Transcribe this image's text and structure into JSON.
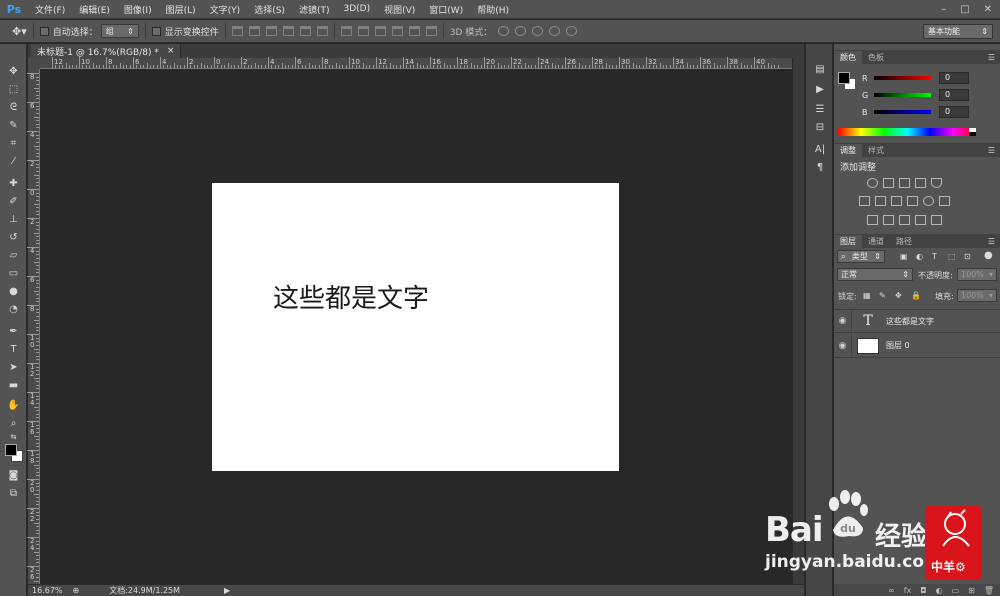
{
  "app": {
    "logo": "Ps"
  },
  "menu": [
    "文件(F)",
    "编辑(E)",
    "图像(I)",
    "图层(L)",
    "文字(Y)",
    "选择(S)",
    "滤镜(T)",
    "3D(D)",
    "视图(V)",
    "窗口(W)",
    "帮助(H)"
  ],
  "window_controls": {
    "minimize": "–",
    "maximize": "□",
    "close": "✕"
  },
  "options": {
    "auto_select_label": "自动选择：",
    "auto_select_value": "组",
    "show_transform_label": "显示变换控件",
    "mode_3d_label": "3D 模式：",
    "workspace": "基本功能"
  },
  "document": {
    "tab_title": "未标题-1 @ 16.7%(RGB/8) *",
    "tab_close": "×",
    "canvas_text": "这些都是文字"
  },
  "ruler": {
    "h_labels": [
      "12",
      "10",
      "8",
      "6",
      "4",
      "2",
      "0",
      "2",
      "4",
      "6",
      "8",
      "10",
      "12",
      "14",
      "16",
      "18",
      "20",
      "22",
      "24",
      "26",
      "28",
      "30",
      "32",
      "34",
      "36",
      "38",
      "40"
    ],
    "v_labels": [
      "8",
      "6",
      "4",
      "2",
      "0",
      "2",
      "4",
      "6",
      "8",
      "1 0",
      "1 2",
      "1 4",
      "1 6",
      "1 8",
      "2 0",
      "2 2",
      "2 4",
      "2 6"
    ]
  },
  "status": {
    "zoom": "16.67%",
    "doc_info": "文档:24.9M/1.25M",
    "arrow": "▶"
  },
  "color_panel": {
    "tabs": [
      "颜色",
      "色板"
    ],
    "sliders": [
      {
        "label": "R",
        "value": "0",
        "gradient": "linear-gradient(to right,#000,#ff0000)"
      },
      {
        "label": "G",
        "value": "0",
        "gradient": "linear-gradient(to right,#000,#00ff00)"
      },
      {
        "label": "B",
        "value": "0",
        "gradient": "linear-gradient(to right,#000,#0000ff)"
      }
    ],
    "foreground": "#000000",
    "background": "#ffffff"
  },
  "adjust_panel": {
    "tabs": [
      "调整",
      "样式"
    ],
    "title": "添加调整"
  },
  "layers_panel": {
    "tabs": [
      "图层",
      "通道",
      "路径"
    ],
    "filter_value": "类型",
    "blend_mode": "正常",
    "opacity_label": "不透明度:",
    "opacity_value": "100%",
    "lock_label": "锁定:",
    "fill_label": "填充:",
    "fill_value": "100%",
    "layers": [
      {
        "name": "这些都是文字",
        "type": "text",
        "thumb": "T"
      },
      {
        "name": "图层 0",
        "type": "image",
        "thumb": ""
      }
    ],
    "footer_icons": [
      "∞",
      "fx",
      "◘",
      "◐",
      "▭",
      "⊞",
      "🗑"
    ]
  },
  "watermark": {
    "brand": "Bai",
    "brand_cn": "经验",
    "url": "jingyan.baidu.com",
    "stamp": "中羊⚙"
  }
}
